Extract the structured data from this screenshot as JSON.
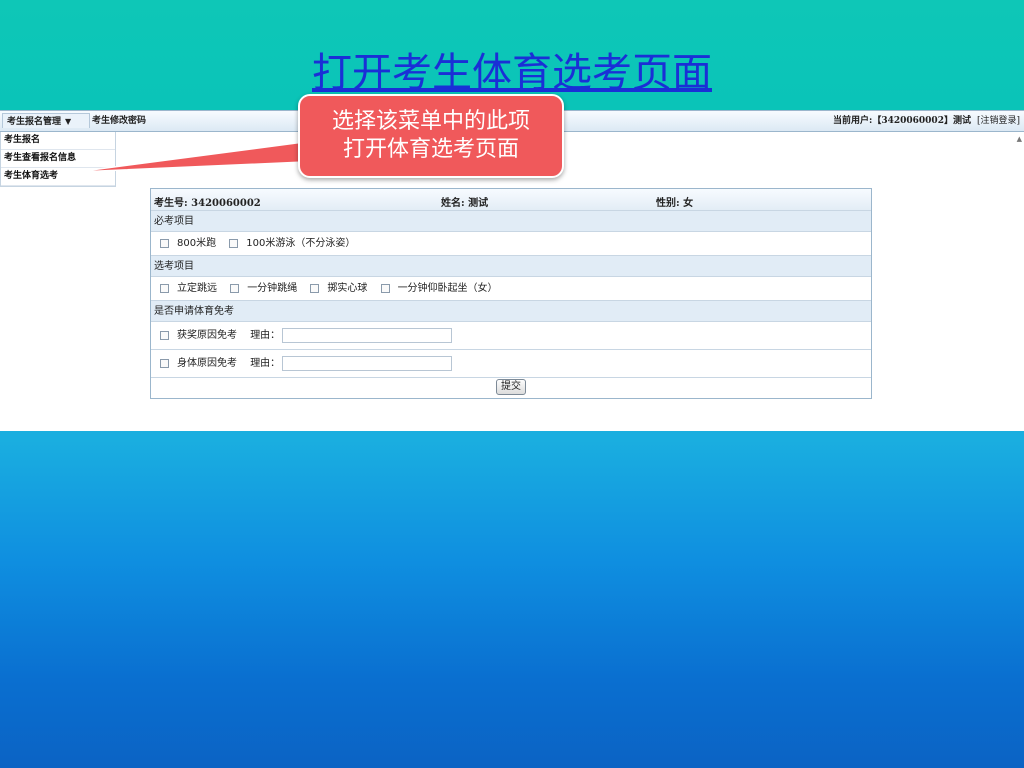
{
  "slide": {
    "title": "打开考生体育选考页面",
    "callout": [
      "选择该菜单中的此项",
      "打开体育选考页面"
    ]
  },
  "topbar": {
    "menu_main": "考生报名管理",
    "menu_password": "考生修改密码",
    "current_user": "当前用户:【3420060002】测试",
    "logout": "[注销登录]"
  },
  "dropdown": {
    "items": [
      "考生报名",
      "考生查看报名信息",
      "考生体育选考"
    ]
  },
  "form": {
    "exam_no": "考生号: 3420060002",
    "name": "姓名: 测试",
    "gender": "性别: 女",
    "required_title": "必考项目",
    "required_items": [
      "800米跑",
      "100米游泳（不分泳姿）"
    ],
    "elective_title": "选考项目",
    "elective_items": [
      "立定跳远",
      "一分钟跳绳",
      "掷实心球",
      "一分钟仰卧起坐（女）"
    ],
    "exempt_title": "是否申请体育免考",
    "exempt_items": [
      "获奖原因免考",
      "身体原因免考"
    ],
    "reason_label": "理由：",
    "submit": "提交"
  },
  "colors": {
    "callout": "#f0595b",
    "title": "#1a2fd6",
    "section_bg": "#e1ecf6"
  },
  "icons": [
    "dropdown-arrow-icon",
    "scroll-up-arrow-icon"
  ]
}
